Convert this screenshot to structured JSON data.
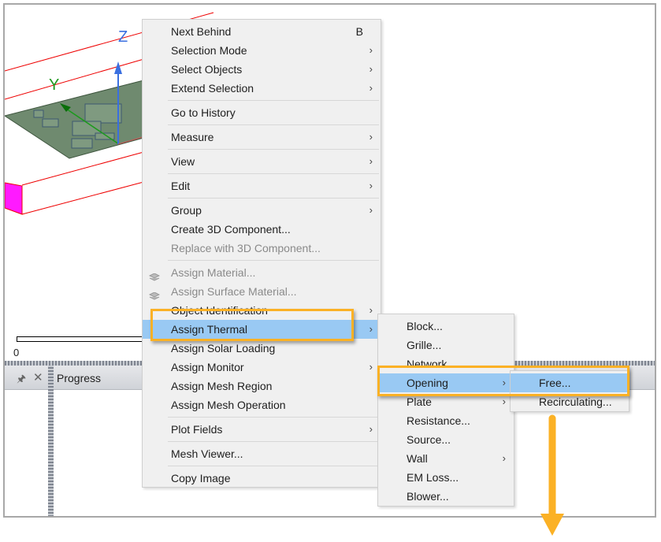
{
  "viewport": {
    "axis_z": "Z",
    "axis_y": "Y",
    "scale_zero": "0"
  },
  "panel": {
    "title": "Progress",
    "pin_icon": "pin-icon",
    "close_icon": "close-icon"
  },
  "colors": {
    "highlight": "#99c9f3",
    "callout": "#fbb125",
    "menu_bg": "#f0f0f0"
  },
  "context_menu": {
    "items": [
      {
        "label": "Next Behind",
        "shortcut": "B"
      },
      {
        "label": "Selection Mode",
        "submenu": true
      },
      {
        "label": "Select Objects",
        "submenu": true
      },
      {
        "label": "Extend Selection",
        "submenu": true
      },
      {
        "sep": true
      },
      {
        "label": "Go to History"
      },
      {
        "sep": true
      },
      {
        "label": "Measure",
        "submenu": true
      },
      {
        "sep": true
      },
      {
        "label": "View",
        "submenu": true
      },
      {
        "sep": true
      },
      {
        "label": "Edit",
        "submenu": true
      },
      {
        "sep": true
      },
      {
        "label": "Group",
        "submenu": true
      },
      {
        "label": "Create 3D Component..."
      },
      {
        "label": "Replace with 3D Component...",
        "disabled": true
      },
      {
        "sep": true
      },
      {
        "label": "Assign Material...",
        "disabled": true,
        "icon": "material-icon"
      },
      {
        "label": "Assign Surface Material...",
        "disabled": true,
        "icon": "surface-material-icon"
      },
      {
        "label": "Object Identification",
        "submenu": true
      },
      {
        "label": "Assign Thermal",
        "submenu": true,
        "highlighted": true
      },
      {
        "label": "Assign Solar Loading"
      },
      {
        "label": "Assign Monitor",
        "submenu": true
      },
      {
        "label": "Assign Mesh Region"
      },
      {
        "label": "Assign Mesh Operation"
      },
      {
        "sep": true
      },
      {
        "label": "Plot Fields",
        "submenu": true
      },
      {
        "sep": true
      },
      {
        "label": "Mesh Viewer..."
      },
      {
        "sep": true
      },
      {
        "label": "Copy Image"
      }
    ]
  },
  "thermal_submenu": {
    "items": [
      {
        "label": "Block..."
      },
      {
        "label": "Grille..."
      },
      {
        "label": "Network..."
      },
      {
        "label": "Opening",
        "submenu": true,
        "highlighted": true
      },
      {
        "label": "Plate",
        "submenu": true
      },
      {
        "label": "Resistance..."
      },
      {
        "label": "Source..."
      },
      {
        "label": "Wall",
        "submenu": true
      },
      {
        "label": "EM Loss..."
      },
      {
        "label": "Blower..."
      }
    ]
  },
  "opening_submenu": {
    "items": [
      {
        "label": "Free...",
        "highlighted": true
      },
      {
        "label": "Recirculating..."
      }
    ]
  }
}
